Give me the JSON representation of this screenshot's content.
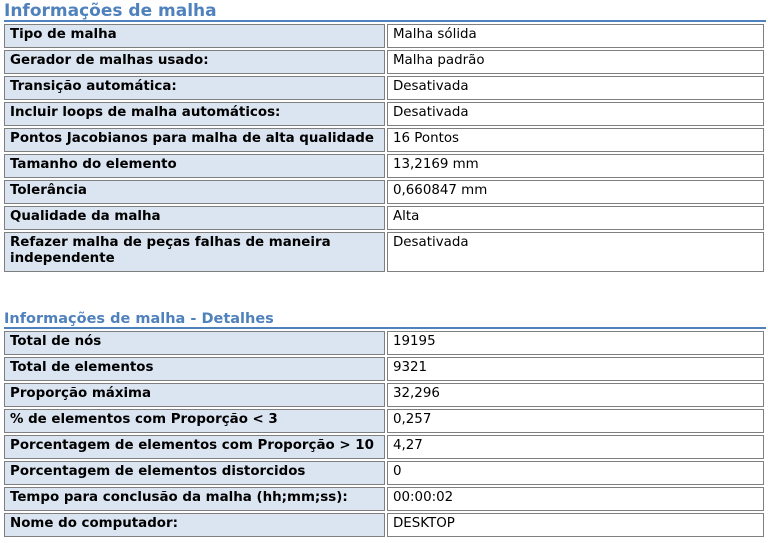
{
  "mesh_info": {
    "title": "Informações de malha",
    "rows": [
      {
        "label": "Tipo de malha",
        "value": "Malha sólida"
      },
      {
        "label": "Gerador de malhas usado:",
        "value": "Malha padrão"
      },
      {
        "label": "Transição automática:",
        "value": "Desativada"
      },
      {
        "label": "Incluir loops de malha automáticos:",
        "value": "Desativada"
      },
      {
        "label": "Pontos Jacobianos para malha de alta qualidade",
        "value": "16 Pontos"
      },
      {
        "label": "Tamanho do elemento",
        "value": "13,2169 mm"
      },
      {
        "label": "Tolerância",
        "value": "0,660847 mm"
      },
      {
        "label": "Qualidade da malha",
        "value": "Alta"
      },
      {
        "label": "Refazer malha de peças falhas de maneira independente",
        "value": "Desativada"
      }
    ]
  },
  "mesh_details": {
    "title": "Informações de malha - Detalhes",
    "rows": [
      {
        "label": "Total de nós",
        "value": "19195"
      },
      {
        "label": "Total de elementos",
        "value": "9321"
      },
      {
        "label": "Proporção máxima",
        "value": "32,296"
      },
      {
        "label": "% de elementos com Proporção < 3",
        "value": "0,257"
      },
      {
        "label": "Porcentagem de elementos com Proporção > 10",
        "value": "4,27"
      },
      {
        "label": "Porcentagem de elementos distorcidos",
        "value": "0"
      },
      {
        "label": "Tempo para conclusão da malha (hh;mm;ss):",
        "value": "00:00:02"
      },
      {
        "label": "Nome do computador:",
        "value": "DESKTOP"
      }
    ]
  }
}
